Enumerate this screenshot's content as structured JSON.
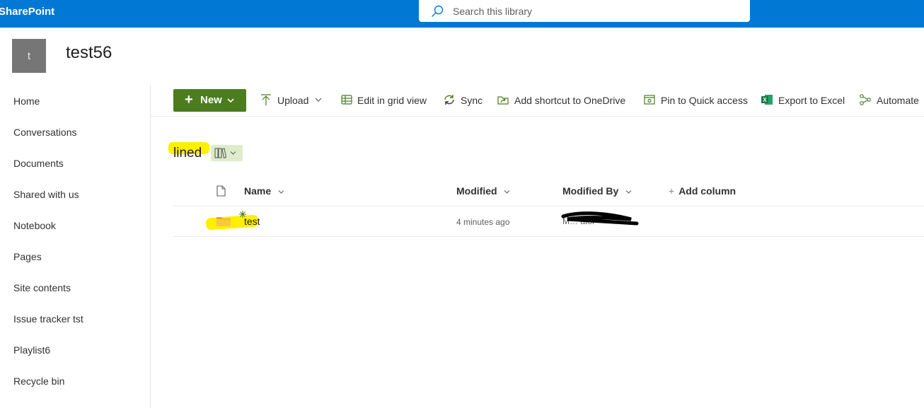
{
  "suite_bar": {
    "app_name": "SharePoint",
    "search_placeholder": "Search this library",
    "accent": "#0078d4"
  },
  "site": {
    "logo_letter": "t",
    "title": "test56"
  },
  "nav": {
    "items": [
      {
        "label": "Home"
      },
      {
        "label": "Conversations"
      },
      {
        "label": "Documents"
      },
      {
        "label": "Shared with us"
      },
      {
        "label": "Notebook"
      },
      {
        "label": "Pages"
      },
      {
        "label": "Site contents"
      },
      {
        "label": "Issue tracker tst"
      },
      {
        "label": "Playlist6"
      },
      {
        "label": "Recycle bin"
      }
    ]
  },
  "command_bar": {
    "new_label": "New",
    "new_color": "#4b7d1f",
    "upload": "Upload",
    "edit_grid": "Edit in grid view",
    "sync": "Sync",
    "add_shortcut": "Add shortcut to OneDrive",
    "pin_quick": "Pin to Quick access",
    "export_excel": "Export to Excel",
    "automate": "Automate"
  },
  "library": {
    "title": "lined",
    "highlight_color": "#ffef00"
  },
  "list": {
    "headers": {
      "name": "Name",
      "modified": "Modified",
      "modified_by": "Modified By",
      "add_column": "Add column"
    },
    "rows": [
      {
        "name": "test",
        "type": "folder",
        "modified": "4 minutes ago",
        "modified_by": "M… ator"
      }
    ]
  }
}
